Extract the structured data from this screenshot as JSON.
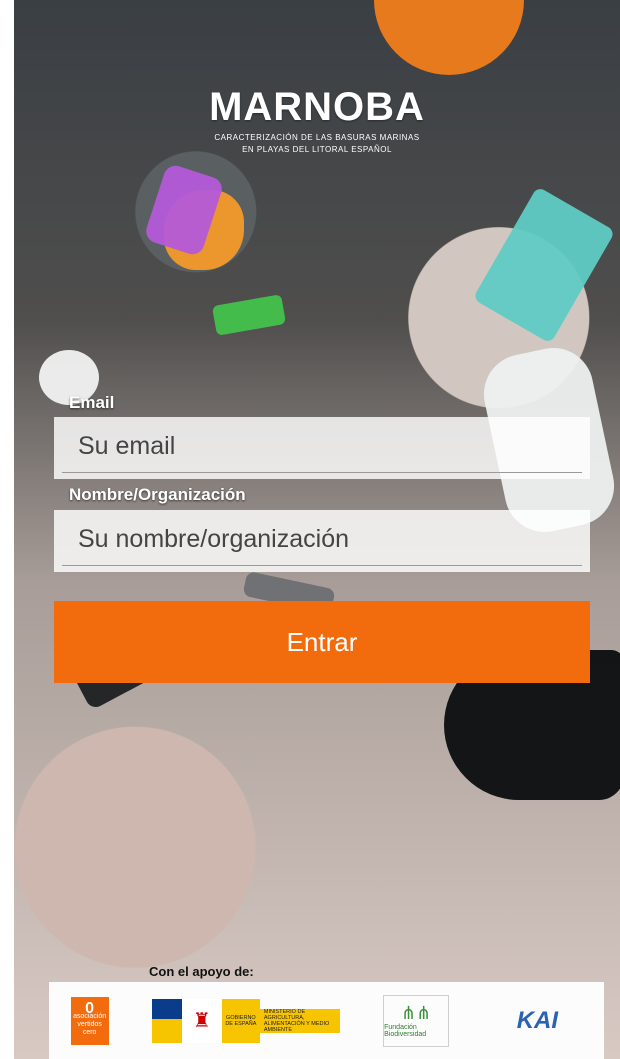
{
  "brand": {
    "title": "MARNOBA",
    "subtitle_line1": "CARACTERIZACIÓN DE LAS BASURAS MARINAS",
    "subtitle_line2": "EN PLAYAS DEL LITORAL ESPAÑOL"
  },
  "form": {
    "email_label": "Email",
    "email_placeholder": "Su email",
    "name_label": "Nombre/Organización",
    "name_placeholder": "Su nombre/organización",
    "submit_label": "Entrar"
  },
  "colors": {
    "accent": "#f26c0d"
  },
  "footer": {
    "support_label": "Con el apoyo de:",
    "logo_vc_number": "0",
    "logo_vc_text": "asociación vertidos cero",
    "logo_gobierno": "GOBIERNO DE ESPAÑA",
    "logo_ministerio": "MINISTERIO DE AGRICULTURA, ALIMENTACIÓN Y MEDIO AMBIENTE",
    "logo_fundacion": "Fundación Biodiversidad",
    "logo_kai": "KAI"
  }
}
